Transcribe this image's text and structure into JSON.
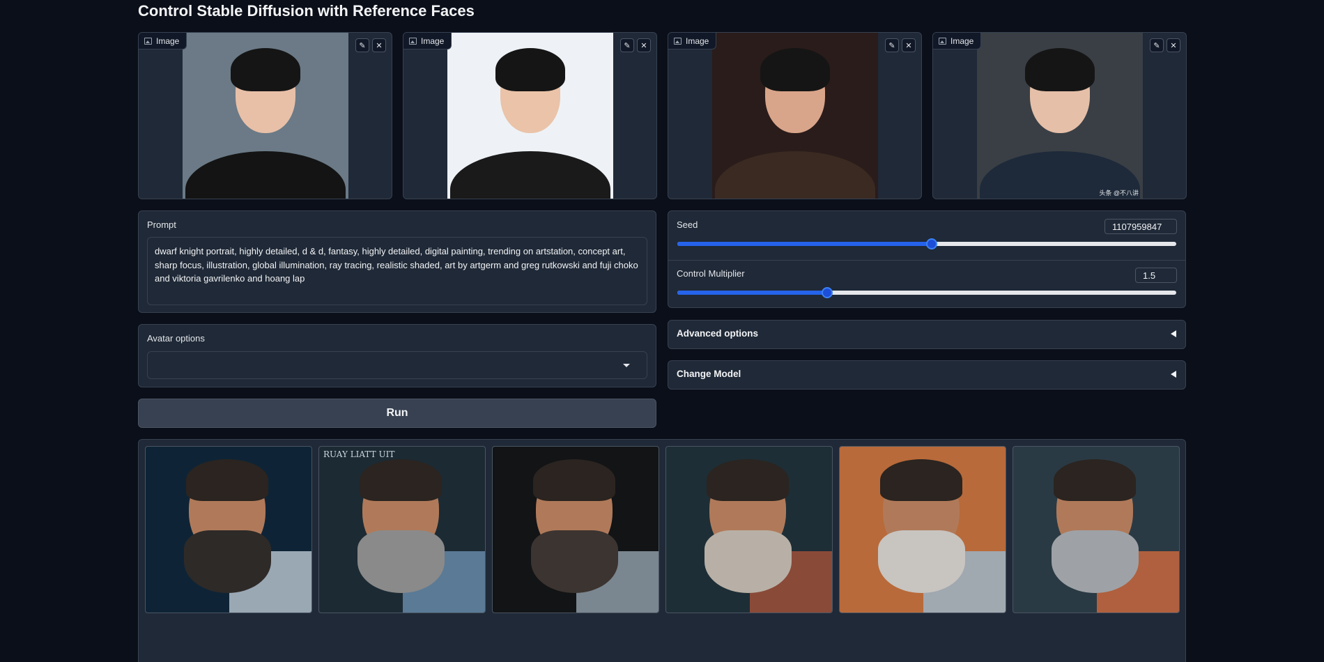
{
  "title": "Control Stable Diffusion with Reference Faces",
  "image_inputs": [
    {
      "label": "Image",
      "bg": "#6b7a86",
      "skin": "#e8c0a8",
      "shirt": "#141414",
      "watermark": ""
    },
    {
      "label": "Image",
      "bg": "#eef2f6",
      "skin": "#eac3a8",
      "shirt": "#1a1a1a",
      "watermark": ""
    },
    {
      "label": "Image",
      "bg": "#2a1c1a",
      "skin": "#d9a58a",
      "shirt": "#3a2a22",
      "watermark": ""
    },
    {
      "label": "Image",
      "bg": "#3a3f45",
      "skin": "#e5bfa8",
      "shirt": "#1e2a3a",
      "watermark": "头条 @不八讲"
    }
  ],
  "prompt": {
    "label": "Prompt",
    "value": "dwarf knight portrait, highly detailed, d & d, fantasy, highly detailed, digital painting, trending on artstation, concept art, sharp focus, illustration, global illumination, ray tracing, realistic shaded, art by artgerm and greg rutkowski and fuji choko and viktoria gavrilenko and hoang lap"
  },
  "avatar_options": {
    "label": "Avatar options",
    "value": ""
  },
  "run_button": "Run",
  "seed": {
    "label": "Seed",
    "value": "1107959847",
    "fraction": 0.51
  },
  "control_multiplier": {
    "label": "Control Multiplier",
    "value": "1.5",
    "fraction": 0.3
  },
  "advanced_options": "Advanced options",
  "change_model": "Change Model",
  "gallery": [
    {
      "bg": "#0e2436",
      "armor": "#9aa8b4",
      "beard": "#2e2a28",
      "watermark": ""
    },
    {
      "bg": "#1c2a33",
      "armor": "#5a7a96",
      "beard": "#8a8a8a",
      "watermark": "RUAY LIATT UIT"
    },
    {
      "bg": "#121416",
      "armor": "#7a8690",
      "beard": "#3c3430",
      "watermark": ""
    },
    {
      "bg": "#1e2e36",
      "armor": "#8a4a38",
      "beard": "#b8b0a6",
      "watermark": ""
    },
    {
      "bg": "#b86a3a",
      "armor": "#a0a8b0",
      "beard": "#c8c4c0",
      "watermark": ""
    },
    {
      "bg": "#2a3a44",
      "armor": "#b0603e",
      "beard": "#9ea2a6",
      "watermark": ""
    }
  ]
}
